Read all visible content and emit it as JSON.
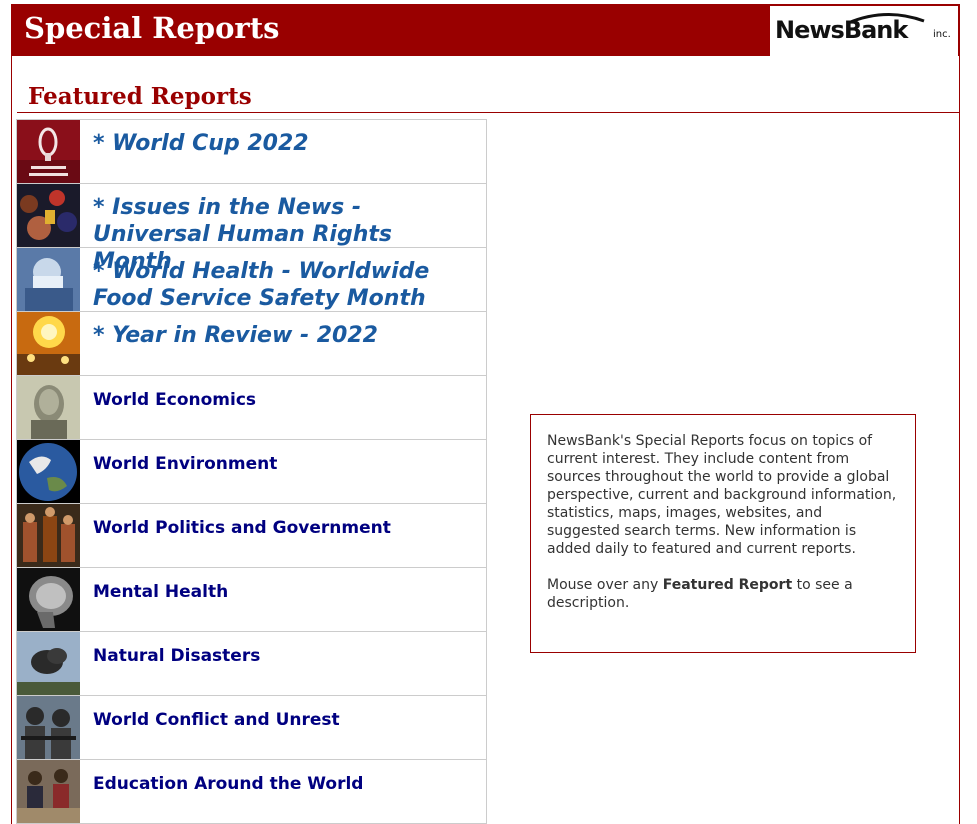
{
  "header": {
    "title": "Special Reports",
    "logo_text": "NewsBank",
    "logo_suffix": "inc."
  },
  "section": {
    "title": "Featured Reports"
  },
  "reports": [
    {
      "label": "* World Cup 2022",
      "featured": true,
      "thumb": "world-cup-trophy-image"
    },
    {
      "label": "* Issues in the News - Universal Human Rights Month",
      "featured": true,
      "thumb": "crowd-protest-image"
    },
    {
      "label": "* World Health - Worldwide Food Service Safety Month",
      "featured": true,
      "thumb": "surgeon-image"
    },
    {
      "label": "* Year in Review - 2022",
      "featured": true,
      "thumb": "fireworks-candles-image"
    },
    {
      "label": "World Economics",
      "featured": false,
      "thumb": "banknote-portrait-image"
    },
    {
      "label": "World Environment",
      "featured": false,
      "thumb": "earth-globe-image"
    },
    {
      "label": "World Politics and Government",
      "featured": false,
      "thumb": "soldiers-image"
    },
    {
      "label": "Mental Health",
      "featured": false,
      "thumb": "brain-scan-image"
    },
    {
      "label": "Natural Disasters",
      "featured": false,
      "thumb": "smoke-plume-image"
    },
    {
      "label": "World Conflict and Unrest",
      "featured": false,
      "thumb": "armed-soldiers-image"
    },
    {
      "label": "Education Around the World",
      "featured": false,
      "thumb": "classroom-image"
    }
  ],
  "info": {
    "paragraph1": "NewsBank's Special Reports focus on topics of current interest. They include content from sources throughout the world to provide a global perspective, current and background information, statistics, maps, images, websites, and suggested search terms. New information is added daily to featured and current reports.",
    "paragraph2_before": "Mouse over any ",
    "paragraph2_bold": "Featured Report",
    "paragraph2_after": " to see a description."
  },
  "colors": {
    "brand": "#990000",
    "link": "#000080",
    "featured_link": "#1a5aa0"
  }
}
